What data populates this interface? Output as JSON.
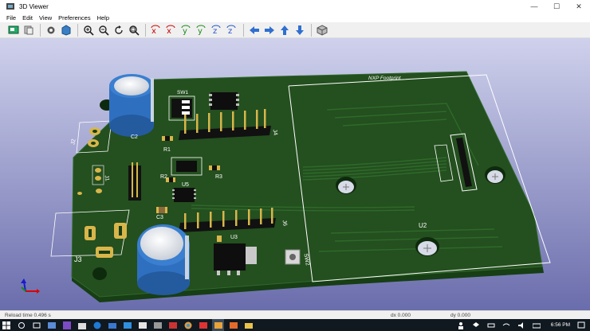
{
  "window": {
    "title": "3D Viewer",
    "controls": [
      "—",
      "☐",
      "✕"
    ]
  },
  "menu": [
    "File",
    "Edit",
    "View",
    "Preferences",
    "Help"
  ],
  "toolbar": {
    "groups": [
      [
        "reload-board-icon",
        "copy-to-clipboard-icon"
      ],
      [
        "settings-icon",
        "rendering-icon"
      ],
      [
        "zoom-in-icon",
        "zoom-out-icon",
        "redraw-icon",
        "zoom-fit-icon"
      ],
      [
        "rotate-x-cw-icon",
        "rotate-x-ccw-icon",
        "rotate-y-cw-icon",
        "rotate-y-ccw-icon",
        "rotate-z-cw-icon",
        "rotate-z-ccw-icon"
      ],
      [
        "pan-left-icon",
        "pan-right-icon",
        "pan-up-icon",
        "pan-down-icon"
      ],
      [
        "ortho-view-icon"
      ]
    ]
  },
  "board_labels": {
    "nxp": "NXP Footprint",
    "sw1": "SW1",
    "c2": "C2",
    "r1": "R1",
    "r2": "R2",
    "r3": "R3",
    "u5": "U5",
    "c3": "C3",
    "j2": "J2",
    "j1": "J1",
    "j3": "J3",
    "u3": "U3",
    "sw2": "SW2",
    "u2": "U2",
    "j4": "J4",
    "j6": "J6"
  },
  "status": {
    "reload": "Reload time 0.496 s",
    "dx": "dx 0.000",
    "dy": "dy 0.000"
  },
  "taskbar": {
    "clock": "6:56 PM",
    "apps": [
      "start",
      "search",
      "task-view",
      "file-explorer",
      "visual-studio",
      "store",
      "edge",
      "mail",
      "photos",
      "kicad",
      "chrome",
      "pcbnew",
      "3d-viewer",
      "folder"
    ]
  },
  "colors": {
    "viewport_bg_top": "#c9cbe8",
    "viewport_bg_bottom": "#6c6fae",
    "pcb": "#1f4e1c",
    "pcb_edge": "#2c6629",
    "silk": "#ffffff",
    "copper": "#d8b64a",
    "cap_blue": "#2f6fbf"
  }
}
